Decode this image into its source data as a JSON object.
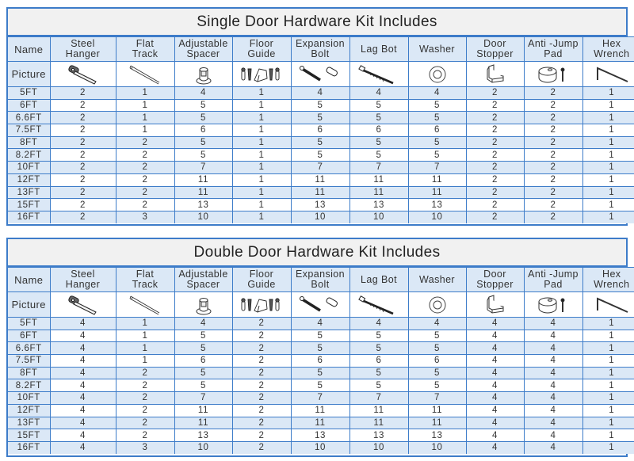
{
  "columns": [
    {
      "key": "name",
      "label": [
        "Name"
      ]
    },
    {
      "key": "steel_hanger",
      "label": [
        "Steel",
        "Hanger"
      ],
      "icon": "steel-hanger-icon"
    },
    {
      "key": "flat_track",
      "label": [
        "Flat",
        "Track"
      ],
      "icon": "flat-track-icon"
    },
    {
      "key": "adjustable_spacer",
      "label": [
        "Adjustable",
        "Spacer"
      ],
      "icon": "adjustable-spacer-icon"
    },
    {
      "key": "floor_guide",
      "label": [
        "Floor",
        "Guide"
      ],
      "icon": "floor-guide-icon"
    },
    {
      "key": "expansion_bolt",
      "label": [
        "Expansion",
        "Bolt"
      ],
      "icon": "expansion-bolt-icon"
    },
    {
      "key": "lag_bot",
      "label": [
        "Lag Bot"
      ],
      "icon": "lag-bolt-icon"
    },
    {
      "key": "washer",
      "label": [
        "Washer"
      ],
      "icon": "washer-icon"
    },
    {
      "key": "door_stopper",
      "label": [
        "Door",
        "Stopper"
      ],
      "icon": "door-stopper-icon"
    },
    {
      "key": "anti_jump_pad",
      "label": [
        "Anti -Jump",
        "Pad"
      ],
      "icon": "anti-jump-pad-icon"
    },
    {
      "key": "hex_wrench",
      "label": [
        "Hex",
        "Wrench"
      ],
      "icon": "hex-wrench-icon"
    }
  ],
  "picture_label": "Picture",
  "tables": [
    {
      "id": "single",
      "title": "Single Door Hardware Kit Includes",
      "rows": [
        [
          "5FT",
          "2",
          "1",
          "4",
          "1",
          "4",
          "4",
          "4",
          "2",
          "2",
          "1"
        ],
        [
          "6FT",
          "2",
          "1",
          "5",
          "1",
          "5",
          "5",
          "5",
          "2",
          "2",
          "1"
        ],
        [
          "6.6FT",
          "2",
          "1",
          "5",
          "1",
          "5",
          "5",
          "5",
          "2",
          "2",
          "1"
        ],
        [
          "7.5FT",
          "2",
          "1",
          "6",
          "1",
          "6",
          "6",
          "6",
          "2",
          "2",
          "1"
        ],
        [
          "8FT",
          "2",
          "2",
          "5",
          "1",
          "5",
          "5",
          "5",
          "2",
          "2",
          "1"
        ],
        [
          "8.2FT",
          "2",
          "2",
          "5",
          "1",
          "5",
          "5",
          "5",
          "2",
          "2",
          "1"
        ],
        [
          "10FT",
          "2",
          "2",
          "7",
          "1",
          "7",
          "7",
          "7",
          "2",
          "2",
          "1"
        ],
        [
          "12FT",
          "2",
          "2",
          "11",
          "1",
          "11",
          "11",
          "11",
          "2",
          "2",
          "1"
        ],
        [
          "13FT",
          "2",
          "2",
          "11",
          "1",
          "11",
          "11",
          "11",
          "2",
          "2",
          "1"
        ],
        [
          "15FT",
          "2",
          "2",
          "13",
          "1",
          "13",
          "13",
          "13",
          "2",
          "2",
          "1"
        ],
        [
          "16FT",
          "2",
          "3",
          "10",
          "1",
          "10",
          "10",
          "10",
          "2",
          "2",
          "1"
        ]
      ]
    },
    {
      "id": "double",
      "title": "Double Door Hardware Kit Includes",
      "rows": [
        [
          "5FT",
          "4",
          "1",
          "4",
          "2",
          "4",
          "4",
          "4",
          "4",
          "4",
          "1"
        ],
        [
          "6FT",
          "4",
          "1",
          "5",
          "2",
          "5",
          "5",
          "5",
          "4",
          "4",
          "1"
        ],
        [
          "6.6FT",
          "4",
          "1",
          "5",
          "2",
          "5",
          "5",
          "5",
          "4",
          "4",
          "1"
        ],
        [
          "7.5FT",
          "4",
          "1",
          "6",
          "2",
          "6",
          "6",
          "6",
          "4",
          "4",
          "1"
        ],
        [
          "8FT",
          "4",
          "2",
          "5",
          "2",
          "5",
          "5",
          "5",
          "4",
          "4",
          "1"
        ],
        [
          "8.2FT",
          "4",
          "2",
          "5",
          "2",
          "5",
          "5",
          "5",
          "4",
          "4",
          "1"
        ],
        [
          "10FT",
          "4",
          "2",
          "7",
          "2",
          "7",
          "7",
          "7",
          "4",
          "4",
          "1"
        ],
        [
          "12FT",
          "4",
          "2",
          "11",
          "2",
          "11",
          "11",
          "11",
          "4",
          "4",
          "1"
        ],
        [
          "13FT",
          "4",
          "2",
          "11",
          "2",
          "11",
          "11",
          "11",
          "4",
          "4",
          "1"
        ],
        [
          "15FT",
          "4",
          "2",
          "13",
          "2",
          "13",
          "13",
          "13",
          "4",
          "4",
          "1"
        ],
        [
          "16FT",
          "4",
          "3",
          "10",
          "2",
          "10",
          "10",
          "10",
          "4",
          "4",
          "1"
        ]
      ]
    }
  ],
  "colors": {
    "border": "#3d7cc9",
    "header_bg": "#dbe8f6",
    "title_bg": "#f1f1f1"
  }
}
